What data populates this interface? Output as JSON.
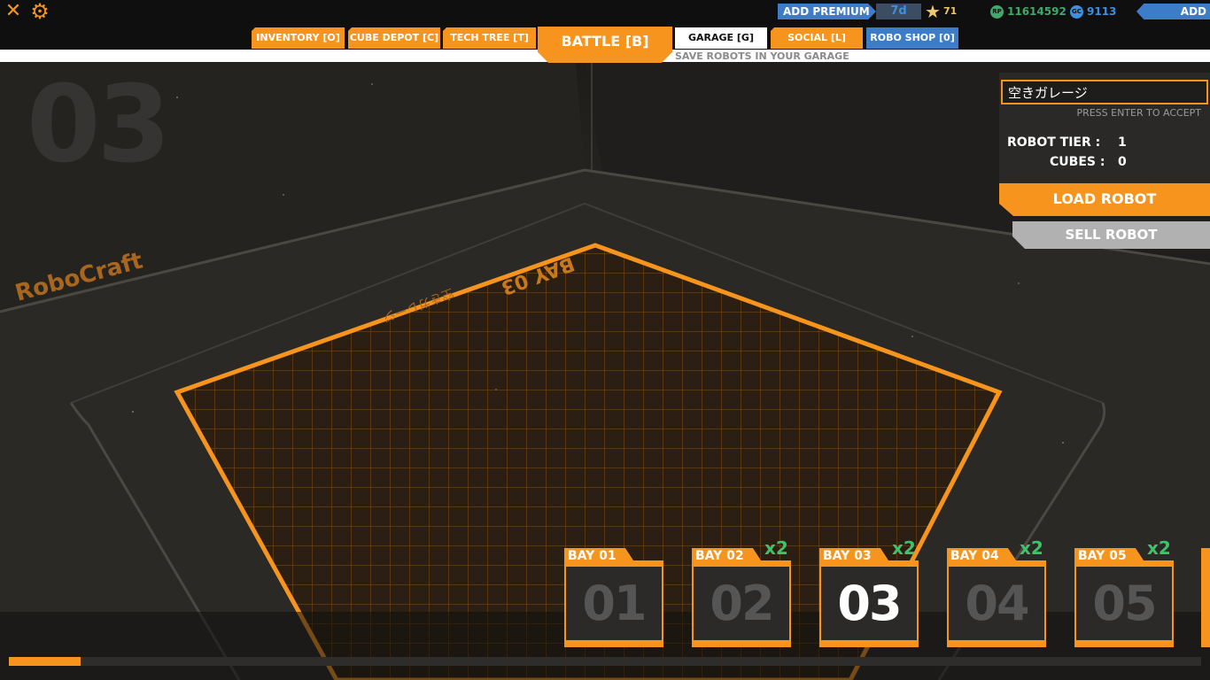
{
  "topbar": {
    "add_premium_label": "ADD PREMIUM",
    "premium_days": "7d",
    "star_count": "71",
    "rp_icon_text": "RP",
    "rp_value": "11614592",
    "gc_icon_text": "GC",
    "gc_value": "9113",
    "add_funds_label": "ADD FUNDS"
  },
  "nav": {
    "tabs": [
      {
        "label": "INVENTORY [O]"
      },
      {
        "label": "CUBE DEPOT [C]"
      },
      {
        "label": "TECH TREE [T]"
      },
      {
        "label": "BATTLE [B]"
      },
      {
        "label": "GARAGE [G]"
      },
      {
        "label": "SOCIAL [L]"
      },
      {
        "label": "ROBO SHOP [0]"
      }
    ],
    "active_subtitle": "SAVE ROBOTS IN YOUR GARAGE"
  },
  "scene": {
    "big_bay_number": "03",
    "floor_logo": "RoboCraft",
    "floor_bay_label": "BAY 03",
    "floor_jp_label": "空きガレージ",
    "accent_color": "#f7941e"
  },
  "panel": {
    "robot_name": "空きガレージ",
    "press_enter": "PRESS ENTER TO ACCEPT",
    "tier_label": "ROBOT TIER :",
    "tier_value": "1",
    "cubes_label": "CUBES :",
    "cubes_value": "0",
    "load_label": "LOAD ROBOT",
    "sell_label": "SELL ROBOT"
  },
  "bays": [
    {
      "label": "BAY  01",
      "number": "01",
      "multiplier": ""
    },
    {
      "label": "BAY  02",
      "number": "02",
      "multiplier": "x2"
    },
    {
      "label": "BAY  03",
      "number": "03",
      "multiplier": "x2"
    },
    {
      "label": "BAY  04",
      "number": "04",
      "multiplier": "x2"
    },
    {
      "label": "BAY  05",
      "number": "05",
      "multiplier": "x2"
    }
  ],
  "progress": 0.06
}
